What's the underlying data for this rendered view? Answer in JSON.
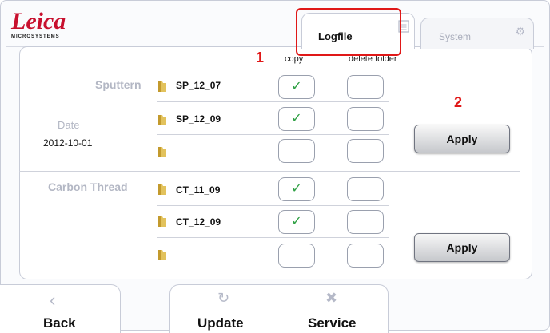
{
  "brand": {
    "name": "Leica",
    "sub": "MICROSYSTEMS"
  },
  "tabs": [
    {
      "label": "Logfile",
      "active": true
    },
    {
      "label": "System",
      "active": false
    }
  ],
  "annotations": {
    "one": "1",
    "two": "2"
  },
  "columns": {
    "copy": "copy",
    "delete": "delete folder"
  },
  "date": {
    "label": "Date",
    "value": "2012-10-01"
  },
  "groups": [
    {
      "label": "Sputtern",
      "folders": [
        {
          "name": "SP_12_07",
          "copy": true,
          "delete": false
        },
        {
          "name": "SP_12_09",
          "copy": true,
          "delete": false
        },
        {
          "name": "_",
          "copy": false,
          "delete": false
        }
      ],
      "apply_label": "Apply"
    },
    {
      "label": "Carbon Thread",
      "folders": [
        {
          "name": "CT_11_09",
          "copy": true,
          "delete": false
        },
        {
          "name": "CT_12_09",
          "copy": true,
          "delete": false
        },
        {
          "name": "_",
          "copy": false,
          "delete": false
        }
      ],
      "apply_label": "Apply"
    }
  ],
  "bottom": {
    "back": "Back",
    "update": "Update",
    "service": "Service"
  },
  "colors": {
    "brand": "#c8102e",
    "highlight": "#e01818",
    "check": "#2ea043"
  }
}
